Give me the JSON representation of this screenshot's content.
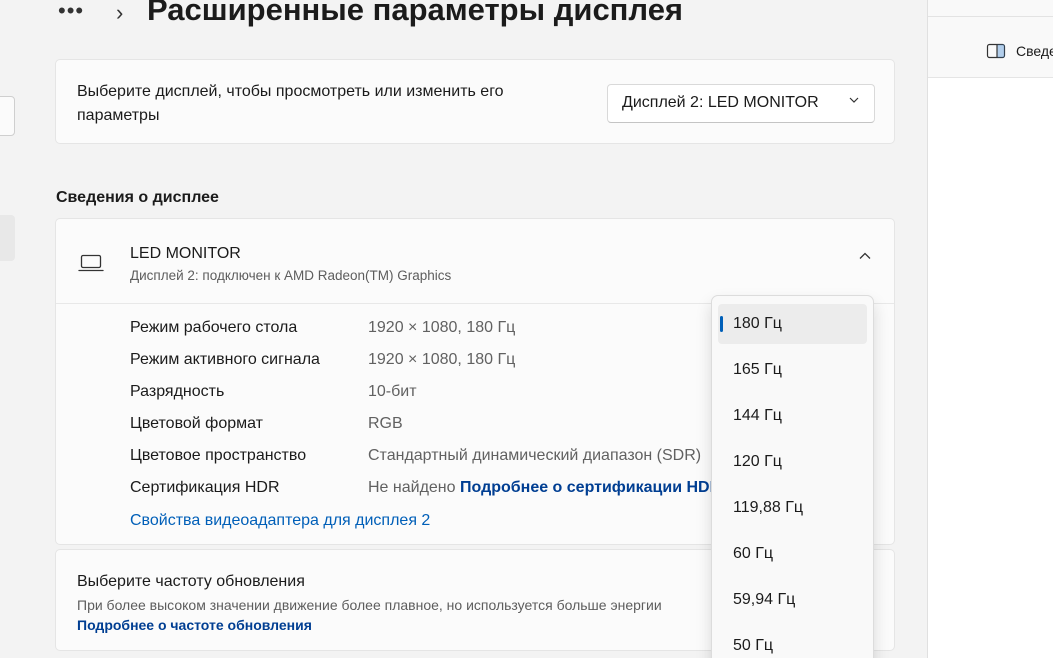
{
  "header": {
    "more_glyph": "•••",
    "chevron_glyph": "›",
    "title": "Расширенные параметры дисплея"
  },
  "select_card": {
    "label": "Выберите дисплей, чтобы просмотреть или изменить его параметры",
    "selected_display": "Дисплей 2: LED MONITOR"
  },
  "display_info": {
    "heading": "Сведения о дисплее",
    "monitor_name": "LED MONITOR",
    "monitor_subtitle": "Дисплей 2: подключен к AMD Radeon(TM) Graphics",
    "rows": [
      {
        "key": "Режим рабочего стола",
        "value": "1920 × 1080, 180 Гц"
      },
      {
        "key": "Режим активного сигнала",
        "value": "1920 × 1080, 180 Гц"
      },
      {
        "key": "Разрядность",
        "value": "10-бит"
      },
      {
        "key": "Цветовой формат",
        "value": "RGB"
      },
      {
        "key": "Цветовое пространство",
        "value": "Стандартный динамический диапазон (SDR)"
      },
      {
        "key": "Сертификация HDR",
        "value": "Не найдено",
        "link": "Подробнее о сертификации HDR"
      }
    ],
    "adapter_link": "Свойства видеоадаптера для дисплея 2"
  },
  "refresh_card": {
    "title": "Выберите частоту обновления",
    "description": "При более высоком значении движение более плавное, но используется больше энергии",
    "link": "Подробнее о частоте обновления"
  },
  "refresh_dropdown": {
    "options": [
      "180 Гц",
      "165 Гц",
      "144 Гц",
      "120 Гц",
      "119,88 Гц",
      "60 Гц",
      "59,94 Гц",
      "50 Гц"
    ],
    "selected": "180 Гц"
  },
  "right_pane": {
    "label": "Сведе"
  },
  "colors": {
    "accent": "#005fb8",
    "link_dark": "#003e92",
    "background": "#f3f3f3",
    "card": "#fbfbfb"
  }
}
